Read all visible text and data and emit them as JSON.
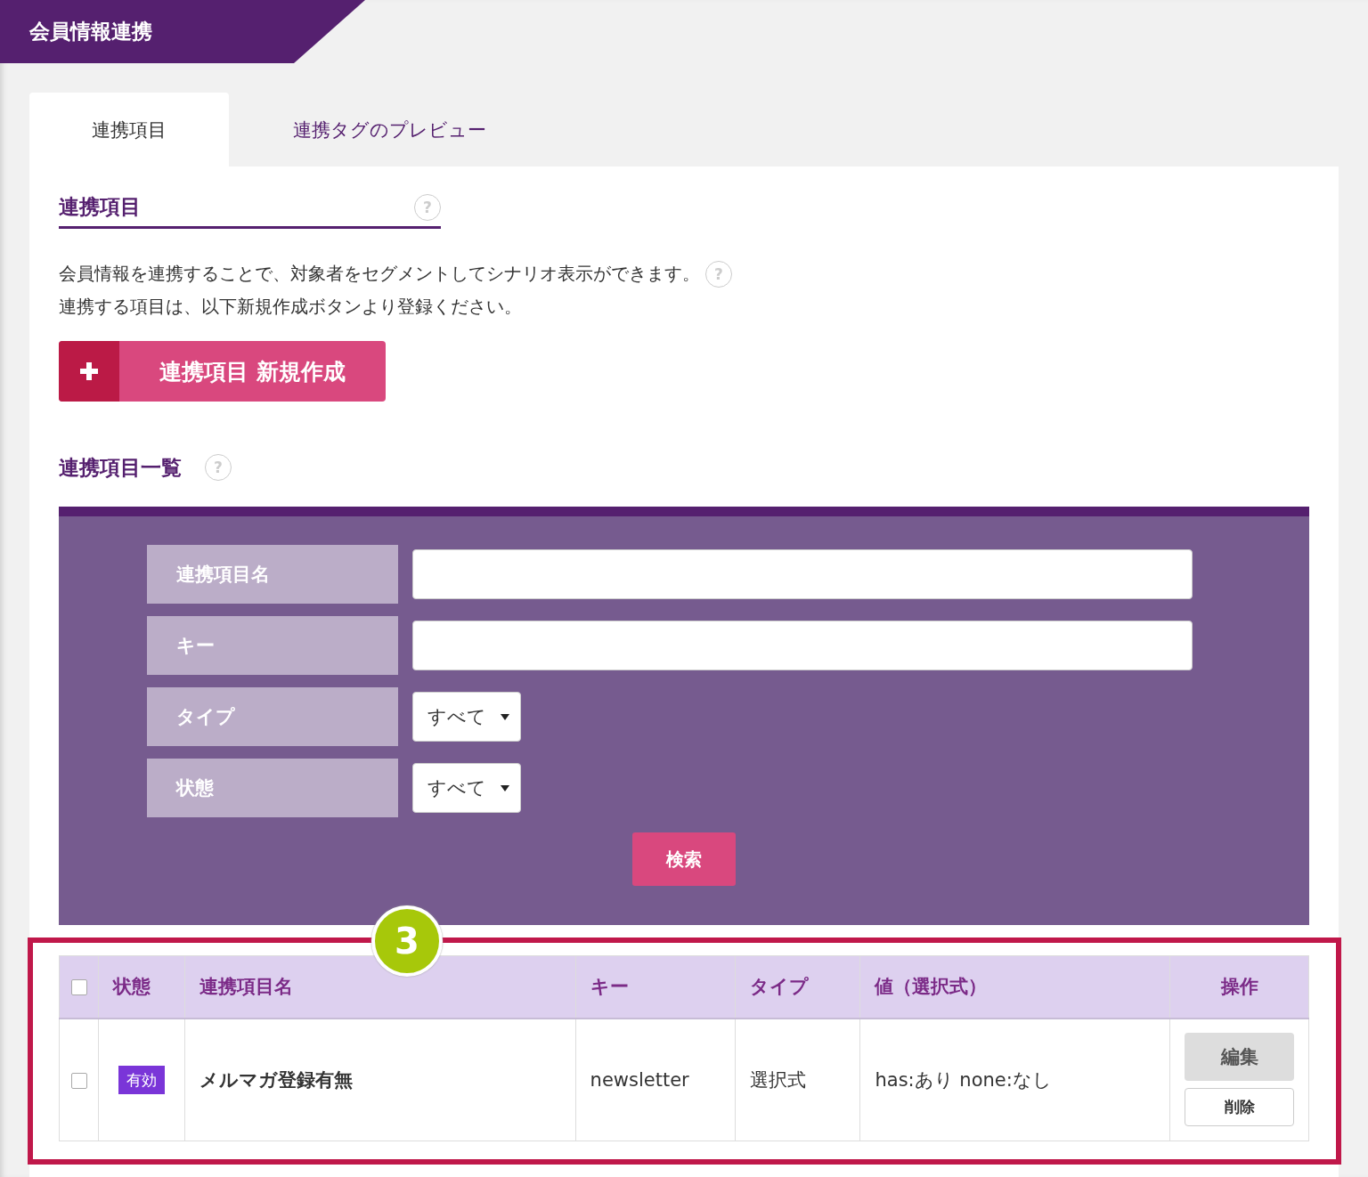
{
  "page_title": "会員情報連携",
  "tabs": [
    {
      "label": "連携項目",
      "selected": true
    },
    {
      "label": "連携タグのプレビュー",
      "selected": false
    }
  ],
  "section": {
    "title": "連携項目",
    "help": "?",
    "description_help": "?",
    "description_lines": [
      "会員情報を連携することで、対象者をセグメントしてシナリオ表示ができます。",
      "連携する項目は、以下新規作成ボタンより登録ください。"
    ],
    "create_button": "連携項目 新規作成"
  },
  "list_title": "連携項目一覧",
  "list_help": "?",
  "filters": [
    {
      "kind": "text",
      "label": "連携項目名"
    },
    {
      "kind": "text",
      "label": "キー"
    },
    {
      "kind": "select",
      "label": "タイプ",
      "value": "すべて"
    },
    {
      "kind": "select",
      "label": "状態",
      "value": "すべて"
    }
  ],
  "search_button": "検索",
  "annotation": {
    "number": "3"
  },
  "table": {
    "columns": [
      "状態",
      "連携項目名",
      "キー",
      "タイプ",
      "値（選択式）",
      "操作"
    ],
    "header_checked": false,
    "rows": [
      {
        "checked": false,
        "status": "有効",
        "name": "メルマガ登録有無",
        "key": "newsletter",
        "type": "選択式",
        "values": "has:あり none:なし",
        "actions": [
          "編集",
          "削除"
        ]
      }
    ]
  }
}
